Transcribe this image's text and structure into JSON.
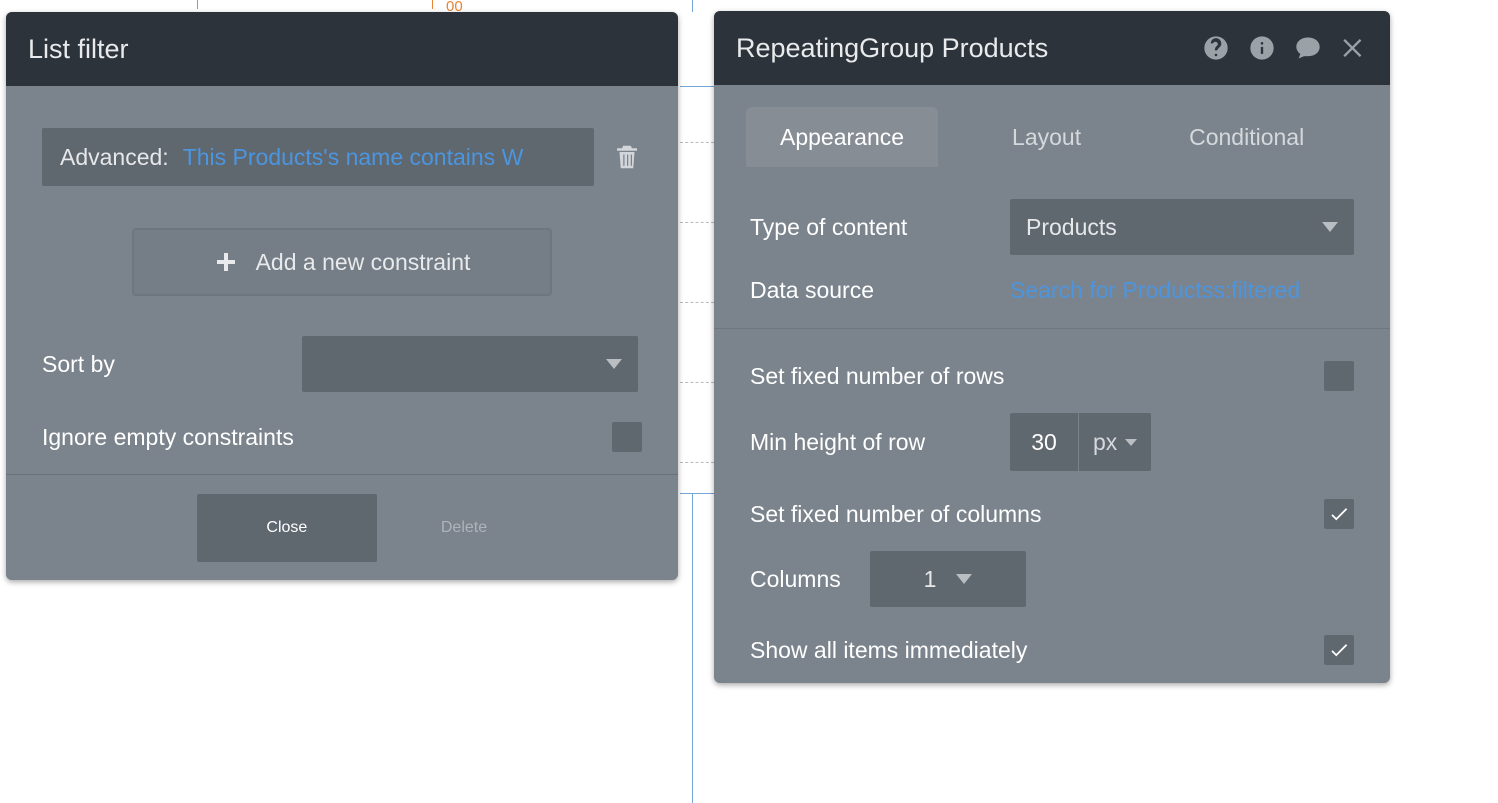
{
  "left": {
    "title": "List filter",
    "constraint_prefix": "Advanced:",
    "constraint_expr": "This Products's name contains W",
    "add_constraint": "Add a new constraint",
    "sort_by_label": "Sort by",
    "sort_by_value": "",
    "ignore_label": "Ignore empty constraints",
    "close": "Close",
    "delete": "Delete"
  },
  "right": {
    "title": "RepeatingGroup Products",
    "tabs": {
      "appearance": "Appearance",
      "layout": "Layout",
      "conditional": "Conditional"
    },
    "type_of_content_label": "Type of content",
    "type_of_content_value": "Products",
    "data_source_label": "Data source",
    "data_source_value": "Search for Productss:filtered",
    "fixed_rows_label": "Set fixed number of rows",
    "min_height_label": "Min height of row",
    "min_height_value": "30",
    "min_height_unit": "px",
    "fixed_cols_label": "Set fixed number of columns",
    "columns_label": "Columns",
    "columns_value": "1",
    "show_all_label": "Show all items immediately"
  },
  "ruler": {
    "val": "00"
  }
}
